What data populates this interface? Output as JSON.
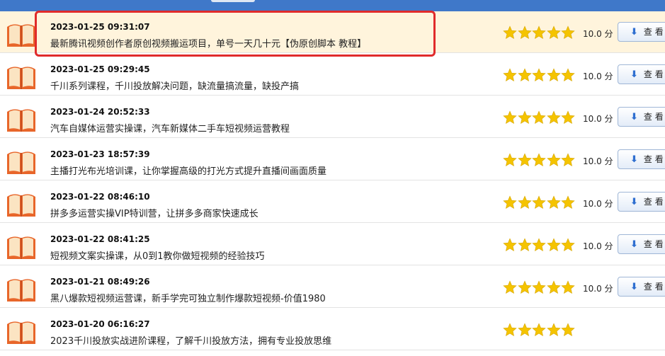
{
  "items": [
    {
      "date": "2023-01-25 09:31:07",
      "title": "最新腾讯视频创作者原创视频搬运项目，单号一天几十元【伪原创脚本 教程】",
      "rating": "10.0 分",
      "button": "查 看",
      "highlighted": true
    },
    {
      "date": "2023-01-25 09:29:45",
      "title": "千川系列课程，千川投放解决问题，缺流量搞流量，缺投产搞",
      "rating": "10.0 分",
      "button": "查 看",
      "highlighted": false
    },
    {
      "date": "2023-01-24 20:52:33",
      "title": "汽车自媒体运营实操课，汽车新媒体二手车短视频运营教程",
      "rating": "10.0 分",
      "button": "查 看",
      "highlighted": false
    },
    {
      "date": "2023-01-23 18:57:39",
      "title": "主播打光布光培训课，让你掌握高级的打光方式提升直播间画面质量",
      "rating": "10.0 分",
      "button": "查 看",
      "highlighted": false
    },
    {
      "date": "2023-01-22 08:46:10",
      "title": "拼多多运营实操VIP特训营，让拼多多商家快速成长",
      "rating": "10.0 分",
      "button": "查 看",
      "highlighted": false
    },
    {
      "date": "2023-01-22 08:41:25",
      "title": "短视频文案实操课，从0到1教你做短视频的经验技巧",
      "rating": "10.0 分",
      "button": "查 看",
      "highlighted": false
    },
    {
      "date": "2023-01-21 08:49:26",
      "title": "黑八爆款短视频运营课，新手学完可独立制作爆款短视频-价值1980",
      "rating": "10.0 分",
      "button": "查 看",
      "highlighted": false
    },
    {
      "date": "2023-01-20 06:16:27",
      "title": "2023千川投放实战进阶课程，了解千川投放方法，拥有专业投放思维",
      "rating": "",
      "button": "",
      "highlighted": false
    }
  ],
  "star_count": 5,
  "icons": {
    "book": "open-book-icon",
    "star": "star-icon",
    "download": "download-arrow-icon"
  },
  "colors": {
    "top_bar": "#3f78c9",
    "highlight_row": "#fff4dc",
    "highlight_border": "#e02b2b",
    "star": "#f5c400",
    "book": "#e8662a"
  }
}
